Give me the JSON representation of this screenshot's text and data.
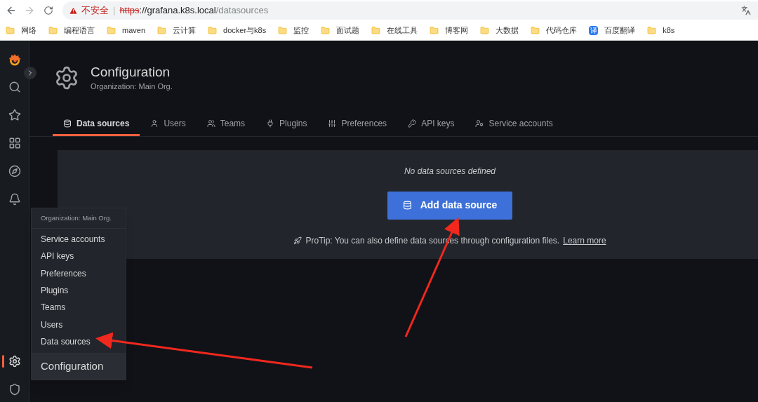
{
  "browser": {
    "security_label": "不安全",
    "separator": "|",
    "url_scheme": "https",
    "url_host": "://grafana.k8s.local",
    "url_path": "/datasources"
  },
  "bookmarks": [
    {
      "label": "网络",
      "kind": "folder"
    },
    {
      "label": "编程语言",
      "kind": "folder"
    },
    {
      "label": "maven",
      "kind": "folder"
    },
    {
      "label": "云计算",
      "kind": "folder"
    },
    {
      "label": "docker与k8s",
      "kind": "folder"
    },
    {
      "label": "监控",
      "kind": "folder"
    },
    {
      "label": "面试题",
      "kind": "folder"
    },
    {
      "label": "在线工具",
      "kind": "folder"
    },
    {
      "label": "博客网",
      "kind": "folder"
    },
    {
      "label": "大数据",
      "kind": "folder"
    },
    {
      "label": "代码仓库",
      "kind": "folder"
    },
    {
      "label": "百度翻译",
      "kind": "app",
      "icon_text": "译"
    },
    {
      "label": "k8s",
      "kind": "folder"
    }
  ],
  "sidebar": {
    "items": [
      {
        "kind": "search",
        "selected": false
      },
      {
        "kind": "starred",
        "selected": false
      },
      {
        "kind": "dashboards",
        "selected": false
      },
      {
        "kind": "explore",
        "selected": false
      },
      {
        "kind": "alerting",
        "selected": false
      }
    ],
    "bottom_items": [
      {
        "kind": "configuration",
        "selected": true
      },
      {
        "kind": "admin",
        "selected": false
      }
    ]
  },
  "page_header": {
    "title": "Configuration",
    "subtitle": "Organization: Main Org."
  },
  "tabs": [
    {
      "label": "Data sources",
      "kind": "datasources",
      "selected": true
    },
    {
      "label": "Users",
      "kind": "users",
      "selected": false
    },
    {
      "label": "Teams",
      "kind": "teams",
      "selected": false
    },
    {
      "label": "Plugins",
      "kind": "plugins",
      "selected": false
    },
    {
      "label": "Preferences",
      "kind": "preferences",
      "selected": false
    },
    {
      "label": "API keys",
      "kind": "apikeys",
      "selected": false
    },
    {
      "label": "Service accounts",
      "kind": "serviceaccounts",
      "selected": false
    }
  ],
  "empty_state": {
    "message": "No data sources defined",
    "button": "Add data source",
    "protip": "ProTip: You can also define data sources through configuration files.",
    "link": "Learn more"
  },
  "menu": {
    "header": "Organization: Main Org.",
    "items": [
      "Service accounts",
      "API keys",
      "Preferences",
      "Plugins",
      "Teams",
      "Users",
      "Data sources"
    ],
    "footer": "Configuration"
  }
}
